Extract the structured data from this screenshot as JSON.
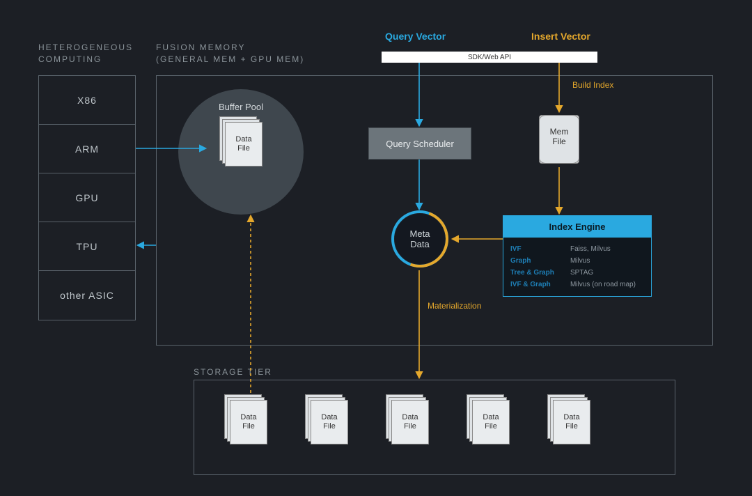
{
  "titles": {
    "heterogeneous": "HETEROGENEOUS COMPUTING",
    "fusion": "FUSION MEMORY\n(GENERAL MEM + GPU MEM)",
    "storage": "STORAGE TIER"
  },
  "compute_units": [
    "X86",
    "ARM",
    "GPU",
    "TPU",
    "other ASIC"
  ],
  "vectors": {
    "query": "Query Vector",
    "insert": "Insert Vector"
  },
  "sdk_bar": "SDK/Web API",
  "buffer_pool": {
    "label": "Buffer Pool",
    "file_label_1": "Data",
    "file_label_2": "File"
  },
  "query_scheduler": "Query Scheduler",
  "mem_file": {
    "l1": "Mem",
    "l2": "File"
  },
  "meta_data": {
    "l1": "Meta",
    "l2": "Data"
  },
  "labels": {
    "build_index": "Build Index",
    "materialization": "Materialization"
  },
  "index_engine": {
    "header": "Index Engine",
    "rows": [
      {
        "k": "IVF",
        "v": "Faiss, Milvus"
      },
      {
        "k": "Graph",
        "v": "Milvus"
      },
      {
        "k": "Tree & Graph",
        "v": "SPTAG"
      },
      {
        "k": "IVF & Graph",
        "v": "Milvus (on road map)"
      }
    ]
  },
  "storage_files": [
    {
      "l1": "Data",
      "l2": "File"
    },
    {
      "l1": "Data",
      "l2": "File"
    },
    {
      "l1": "Data",
      "l2": "File"
    },
    {
      "l1": "Data",
      "l2": "File"
    },
    {
      "l1": "Data",
      "l2": "File"
    }
  ],
  "colors": {
    "blue": "#2aa9e0",
    "orange": "#e5a82c",
    "bg": "#1c1f25"
  }
}
